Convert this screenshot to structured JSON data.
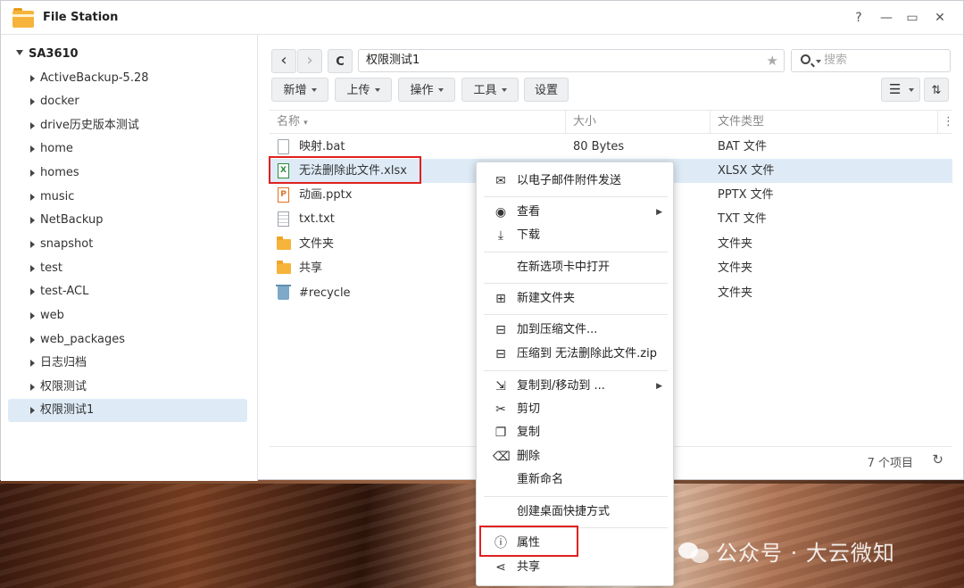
{
  "window": {
    "title": "File Station",
    "controls": {
      "help": "?",
      "minimize": "—",
      "maximize": "▭",
      "close": "✕"
    }
  },
  "sidebar": {
    "root": "SA3610",
    "items": [
      {
        "label": "ActiveBackup-5.28"
      },
      {
        "label": "docker"
      },
      {
        "label": "drive历史版本测试"
      },
      {
        "label": "home"
      },
      {
        "label": "homes"
      },
      {
        "label": "music"
      },
      {
        "label": "NetBackup"
      },
      {
        "label": "snapshot"
      },
      {
        "label": "test"
      },
      {
        "label": "test-ACL"
      },
      {
        "label": "web"
      },
      {
        "label": "web_packages"
      },
      {
        "label": "日志归档"
      },
      {
        "label": "权限测试"
      },
      {
        "label": "权限测试1"
      }
    ]
  },
  "toolbar": {
    "back": "‹",
    "forward": "›",
    "refresh": "C",
    "path": "权限测试1",
    "search_placeholder": "搜索",
    "buttons": {
      "create": "新增",
      "upload": "上传",
      "action": "操作",
      "tools": "工具",
      "settings": "设置"
    }
  },
  "table": {
    "columns": {
      "name": "名称",
      "size": "大小",
      "type": "文件类型"
    },
    "rows": [
      {
        "name": "映射.bat",
        "size": "80 Bytes",
        "type": "BAT 文件"
      },
      {
        "name": "无法删除此文件.xlsx",
        "size": "",
        "type": "XLSX 文件"
      },
      {
        "name": "动画.pptx",
        "size": "",
        "type": "PPTX 文件"
      },
      {
        "name": "txt.txt",
        "size": "",
        "type": "TXT 文件"
      },
      {
        "name": "文件夹",
        "size": "",
        "type": "文件夹"
      },
      {
        "name": "共享",
        "size": "",
        "type": "文件夹"
      },
      {
        "name": "#recycle",
        "size": "",
        "type": "文件夹"
      }
    ]
  },
  "status": {
    "count": "7 个项目"
  },
  "context_menu": {
    "email": "以电子邮件附件发送",
    "view": "查看",
    "download": "下载",
    "open_new_tab": "在新选项卡中打开",
    "new_folder": "新建文件夹",
    "add_archive": "加到压缩文件...",
    "compress_to": "压缩到 无法删除此文件.zip",
    "copy_move": "复制到/移动到 ...",
    "cut": "剪切",
    "copy": "复制",
    "delete": "删除",
    "rename": "重新命名",
    "desktop_shortcut": "创建桌面快捷方式",
    "properties": "属性",
    "share": "共享"
  },
  "watermark": "公众号 · 大云微知"
}
